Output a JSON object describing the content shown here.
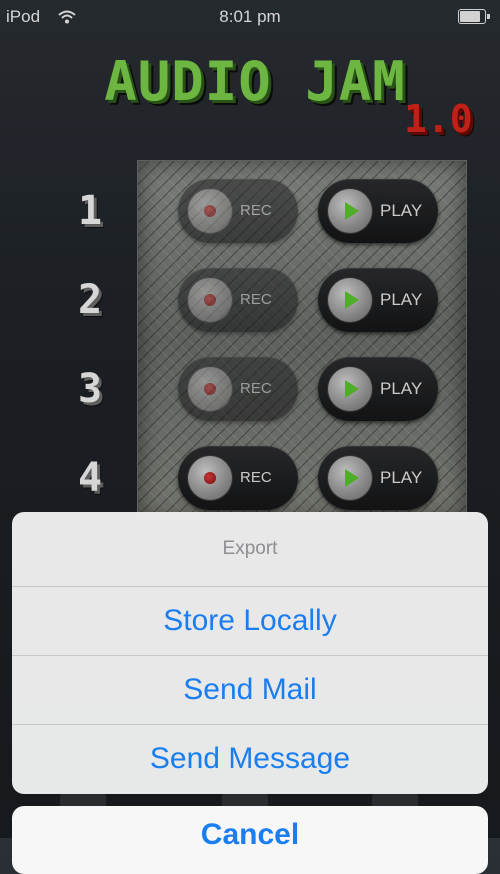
{
  "status": {
    "carrier": "iPod",
    "time": "8:01 pm"
  },
  "app": {
    "title": "AUDIO JAM",
    "version": "1.0"
  },
  "tracks": [
    {
      "number": "1",
      "rec_label": "REC",
      "play_label": "PLAY",
      "rec_active": false
    },
    {
      "number": "2",
      "rec_label": "REC",
      "play_label": "PLAY",
      "rec_active": false
    },
    {
      "number": "3",
      "rec_label": "REC",
      "play_label": "PLAY",
      "rec_active": false
    },
    {
      "number": "4",
      "rec_label": "REC",
      "play_label": "PLAY",
      "rec_active": true
    }
  ],
  "action_sheet": {
    "title": "Export",
    "options": [
      "Store Locally",
      "Send Mail",
      "Send Message"
    ],
    "cancel_label": "Cancel"
  },
  "colors": {
    "title_green": "#7bd04a",
    "version_red": "#d9261c",
    "ios_blue": "#1a7ef0"
  }
}
